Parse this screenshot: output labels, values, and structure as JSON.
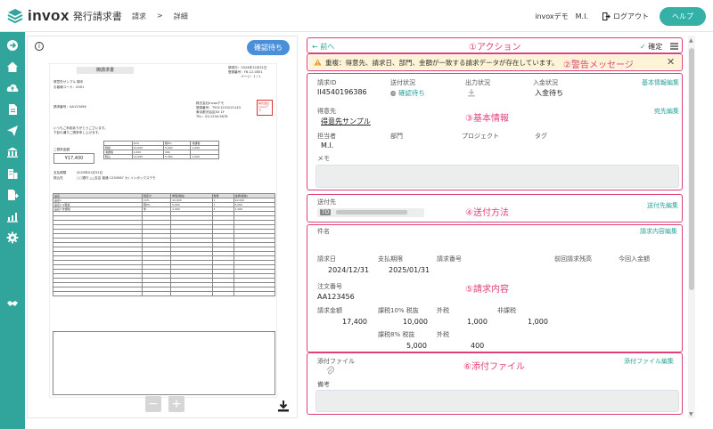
{
  "app": {
    "logo_text": "invox",
    "logo_sub": "発行請求書",
    "breadcrumb": [
      "請求",
      ">",
      "詳細"
    ],
    "company": "invoxデモ",
    "user": "M.I.",
    "logout": "ログアウト",
    "help": "ヘルプ"
  },
  "preview": {
    "status": "確認待ち",
    "doc": {
      "title": "御請求書",
      "customer": "得意先サンプル 御中",
      "customer_code": "お客様コード：0001",
      "invoice_no": "請求番号：AA123456",
      "issue_date": "請求日：2024年12月31日",
      "reg_no": "登録番号：F6-12-0001",
      "page": "ページ：1 / 1",
      "issuer": "株式会社invoxデモ",
      "issuer_reg": "登録番号：T5011201021143",
      "issuer_addr": "東京都渋谷区XX 1F",
      "issuer_tel": "TEL：03-1234-5678",
      "greeting1": "いつもご利用ありがとうございます。",
      "greeting2": "下記の通りご請求申し上げます。",
      "amount_label": "ご請求金額",
      "amount": "¥17,400",
      "due_label": "支払期限",
      "due_value": "2025年01月31日",
      "bank_label": "振込先",
      "bank_value": "○○銀行 △△支店 普通 1234567 カ) インボックスデモ",
      "tax_headers": [
        "",
        "10%",
        "軽8%",
        "非課税"
      ],
      "tax_rows": [
        [
          "税抜",
          "10,000",
          "5,000",
          "1,000"
        ],
        [
          "消費税",
          "1,000",
          "400",
          ""
        ],
        [
          "税込",
          "11,000",
          "5,400",
          "1,000"
        ]
      ],
      "line_headers": [
        "品名",
        "税区分",
        "単価(税抜)",
        "数量",
        "金額(税抜)"
      ],
      "lines": [
        [
          "品名1",
          "10%",
          "10,000",
          "1",
          "10,000"
        ],
        [
          "品名2 ※軽減",
          "軽8%",
          "5,000",
          "1",
          "5,000"
        ],
        [
          "品名3 非課税",
          "非",
          "1,000",
          "1",
          "1,000"
        ]
      ],
      "seal_text": "株式会社invoxデモ"
    },
    "pager_minus": "−",
    "pager_plus": "+"
  },
  "details": {
    "back": "前へ",
    "annot_action": "①アクション",
    "confirm": "確定",
    "annot_warn": "②警告メッセージ",
    "alert_text": "重複：得意先、請求日、部門、金額が一致する請求データが存在しています。",
    "annot_basic": "③基本情報",
    "basic_edit": "基本情報編集",
    "labels": {
      "invoice_id": "請求ID",
      "send_status": "送付状況",
      "output_status": "出力状況",
      "payment_status": "入金状況",
      "customer": "得意先",
      "owner": "担当者",
      "department": "部門",
      "project": "プロジェクト",
      "tag": "タグ",
      "memo": "メモ"
    },
    "values": {
      "invoice_id": "II4540196386",
      "send_status": "確認待ち",
      "payment_status": "入金待ち",
      "customer": "得意先サンプル",
      "owner": "M.I."
    },
    "dest_edit": "宛先編集",
    "annot_send": "④送付方法",
    "send_to_label": "送付先",
    "send_to_tag": "TO",
    "send_edit": "送付先編集",
    "subject_label": "件名",
    "annot_content": "⑤請求内容",
    "content_edit": "請求内容編集",
    "content_labels": {
      "invoice_date": "請求日",
      "due": "支払期限",
      "invoice_no": "請求番号",
      "prev_balance": "前回請求残高",
      "this_payment": "今回入金額",
      "order_no": "注文番号",
      "invoice_amount": "請求金額",
      "tax10": "課税10% 税抜",
      "ext_tax": "外税",
      "non_tax": "非課税",
      "tax8": "課税8% 税抜",
      "ext_tax2": "外税"
    },
    "content_values": {
      "invoice_date": "2024/12/31",
      "due": "2025/01/31",
      "order_no": "AA123456",
      "invoice_amount": "17,400",
      "tax10": "10,000",
      "ext_tax": "1,000",
      "non_tax": "1,000",
      "tax8": "5,000",
      "ext_tax2": "400"
    },
    "annot_attach": "⑥添付ファイル",
    "attach_label": "添付ファイル",
    "attach_edit": "添付ファイル編集",
    "remarks_label": "備考"
  }
}
